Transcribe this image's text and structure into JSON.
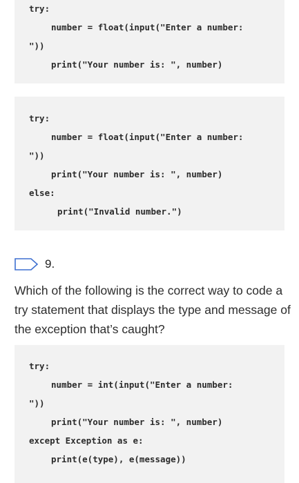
{
  "block1": {
    "lines": [
      "try:",
      "number = float(input(\"Enter a number:",
      "\"))",
      "print(\"Your number is: \", number)"
    ]
  },
  "block2": {
    "lines": [
      "try:",
      "number = float(input(\"Enter a number:",
      "\"))",
      "print(\"Your number is: \", number)",
      "else:",
      "print(\"Invalid number.\")"
    ]
  },
  "question": {
    "number": "9.",
    "text": "Which of the following is the correct way to code a try statement that displays the type and message of the exception that’s caught?"
  },
  "block3": {
    "lines": [
      "try:",
      "number = int(input(\"Enter a number:",
      "\"))",
      "print(\"Your number is: \", number)",
      "except Exception as e:",
      "print(e(type), e(message))"
    ]
  },
  "colors": {
    "code_bg": "#f2f2f2",
    "flag_border": "#3d6fd0"
  }
}
